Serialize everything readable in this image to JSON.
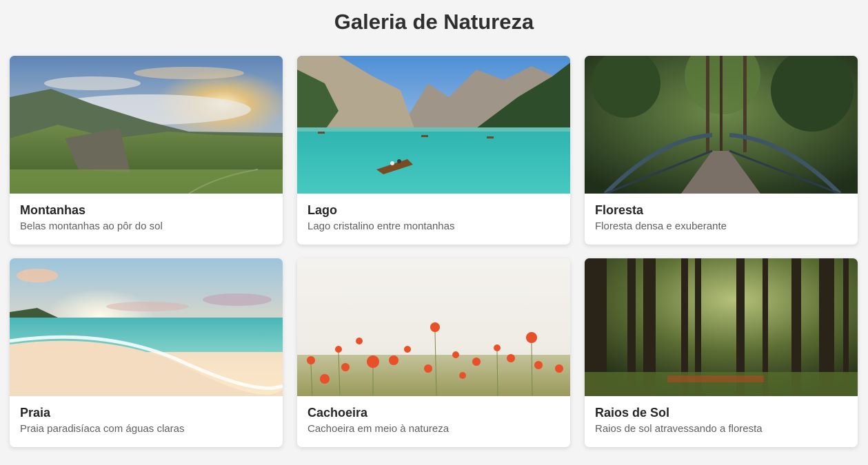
{
  "page": {
    "title": "Galeria de Natureza"
  },
  "gallery": [
    {
      "title": "Montanhas",
      "description": "Belas montanhas ao pôr do sol",
      "image": "mountains-sunset"
    },
    {
      "title": "Lago",
      "description": "Lago cristalino entre montanhas",
      "image": "mountain-lake-boat"
    },
    {
      "title": "Floresta",
      "description": "Floresta densa e exuberante",
      "image": "forest-bridge"
    },
    {
      "title": "Praia",
      "description": "Praia paradisíaca com águas claras",
      "image": "beach-sunset"
    },
    {
      "title": "Cachoeira",
      "description": "Cachoeira em meio à natureza",
      "image": "poppy-field"
    },
    {
      "title": "Raios de Sol",
      "description": "Raios de sol atravessando a floresta",
      "image": "sunlit-forest"
    }
  ]
}
